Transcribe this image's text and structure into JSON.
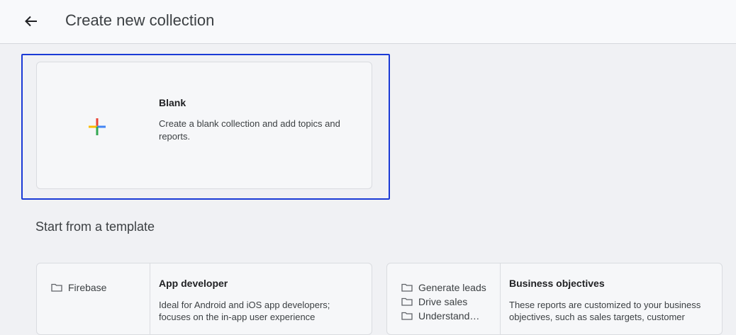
{
  "header": {
    "back_icon": "arrow-left-icon",
    "title": "Create new collection"
  },
  "blank_card": {
    "icon": "multicolor-plus-icon",
    "title": "Blank",
    "description": "Create a blank collection and add topics and reports."
  },
  "templates_section": {
    "title": "Start from a template",
    "cards": [
      {
        "folders": [
          "Firebase"
        ],
        "title": "App developer",
        "description": "Ideal for Android and iOS app developers; focuses on the in-app user experience"
      },
      {
        "folders": [
          "Generate leads",
          "Drive sales",
          "Understand…"
        ],
        "title": "Business objectives",
        "description": "These reports are customized to your business objectives, such as sales targets, customer"
      }
    ]
  },
  "colors": {
    "focus_ring": "#1a3ad6",
    "plus_red": "#ea4335",
    "plus_blue": "#4285f4",
    "plus_yellow": "#fbbc04",
    "plus_green": "#34a853"
  }
}
